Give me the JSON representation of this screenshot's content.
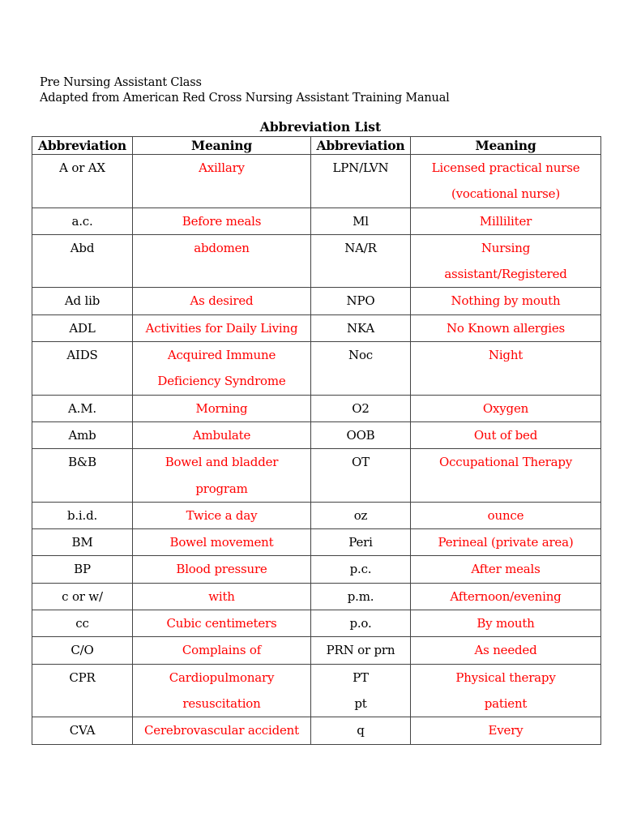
{
  "header": {
    "line1": "Pre Nursing Assistant Class",
    "line2": "Adapted from  American Red Cross Nursing Assistant Training Manual"
  },
  "title": "Abbreviation List",
  "columns": [
    "Abbreviation",
    "Meaning",
    "Abbreviation",
    "Meaning"
  ],
  "colors": {
    "meaning_text": "#ff0000",
    "abbreviation_text": "#000000"
  },
  "rows": [
    {
      "a1": [
        "A or AX"
      ],
      "m1": [
        "Axillary"
      ],
      "a2": [
        "LPN/LVN"
      ],
      "m2": [
        "Licensed practical nurse",
        "(vocational nurse)"
      ]
    },
    {
      "a1": [
        "a.c."
      ],
      "m1": [
        "Before meals"
      ],
      "a2": [
        "Ml"
      ],
      "m2": [
        "Milliliter"
      ]
    },
    {
      "a1": [
        "Abd"
      ],
      "m1": [
        "abdomen"
      ],
      "a2": [
        "NA/R"
      ],
      "m2": [
        "Nursing",
        "assistant/Registered"
      ]
    },
    {
      "a1": [
        "Ad lib"
      ],
      "m1": [
        "As desired"
      ],
      "a2": [
        "NPO"
      ],
      "m2": [
        "Nothing by mouth"
      ]
    },
    {
      "a1": [
        "ADL"
      ],
      "m1": [
        "Activities for Daily Living"
      ],
      "a2": [
        "NKA"
      ],
      "m2": [
        "No Known allergies"
      ]
    },
    {
      "a1": [
        "AIDS"
      ],
      "m1": [
        "Acquired Immune",
        "Deficiency Syndrome"
      ],
      "a2": [
        "Noc"
      ],
      "m2": [
        "Night"
      ]
    },
    {
      "a1": [
        "A.M."
      ],
      "m1": [
        "Morning"
      ],
      "a2": [
        "O2"
      ],
      "m2": [
        "Oxygen"
      ]
    },
    {
      "a1": [
        "Amb"
      ],
      "m1": [
        "Ambulate"
      ],
      "a2": [
        "OOB"
      ],
      "m2": [
        "Out of bed"
      ]
    },
    {
      "a1": [
        "B&B"
      ],
      "m1": [
        "Bowel and bladder",
        "program"
      ],
      "a2": [
        "OT"
      ],
      "m2": [
        "Occupational Therapy"
      ]
    },
    {
      "a1": [
        "b.i.d."
      ],
      "m1": [
        "Twice a day"
      ],
      "a2": [
        "oz"
      ],
      "m2": [
        "ounce"
      ]
    },
    {
      "a1": [
        "BM"
      ],
      "m1": [
        "Bowel movement"
      ],
      "a2": [
        "Peri"
      ],
      "m2": [
        "Perineal (private area)"
      ]
    },
    {
      "a1": [
        "BP"
      ],
      "m1": [
        "Blood pressure"
      ],
      "a2": [
        "p.c."
      ],
      "m2": [
        "After meals"
      ]
    },
    {
      "a1": [
        "c or w/"
      ],
      "m1": [
        "with"
      ],
      "a2": [
        "p.m."
      ],
      "m2": [
        "Afternoon/evening"
      ]
    },
    {
      "a1": [
        "cc"
      ],
      "m1": [
        "Cubic centimeters"
      ],
      "a2": [
        "p.o."
      ],
      "m2": [
        "By mouth"
      ]
    },
    {
      "a1": [
        "C/O"
      ],
      "m1": [
        "Complains of"
      ],
      "a2": [
        "PRN or prn"
      ],
      "m2": [
        "As needed"
      ]
    },
    {
      "a1": [
        "CPR"
      ],
      "m1": [
        "Cardiopulmonary",
        "resuscitation"
      ],
      "a2": [
        "PT",
        "pt"
      ],
      "m2": [
        "Physical therapy",
        "patient"
      ]
    },
    {
      "a1": [
        "CVA"
      ],
      "m1": [
        "Cerebrovascular accident"
      ],
      "a2": [
        "q"
      ],
      "m2": [
        "Every"
      ]
    }
  ]
}
